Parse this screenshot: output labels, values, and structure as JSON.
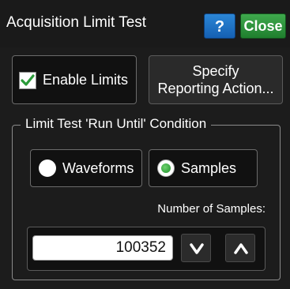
{
  "window": {
    "title": "Acquisition Limit Test",
    "help_label": "?",
    "close_label": "Close"
  },
  "enable_limits": {
    "label": "Enable Limits",
    "checked": true
  },
  "specify_button": {
    "line1": "Specify",
    "line2": "Reporting Action..."
  },
  "run_until": {
    "group_title": "Limit Test 'Run Until' Condition",
    "options": [
      {
        "label": "Waveforms",
        "selected": false
      },
      {
        "label": "Samples",
        "selected": true
      }
    ],
    "number_label": "Number of Samples:",
    "number_value": "100352"
  },
  "icons": {
    "checkmark": "check-icon",
    "decrement": "chevron-down-icon",
    "increment": "chevron-up-icon"
  },
  "colors": {
    "background": "#1c1c1c",
    "help_blue": "#1f6fc4",
    "close_green": "#2e9a3c",
    "checkmark_green": "#2b9b3a",
    "radio_selected_green": "#1d8f2a"
  }
}
